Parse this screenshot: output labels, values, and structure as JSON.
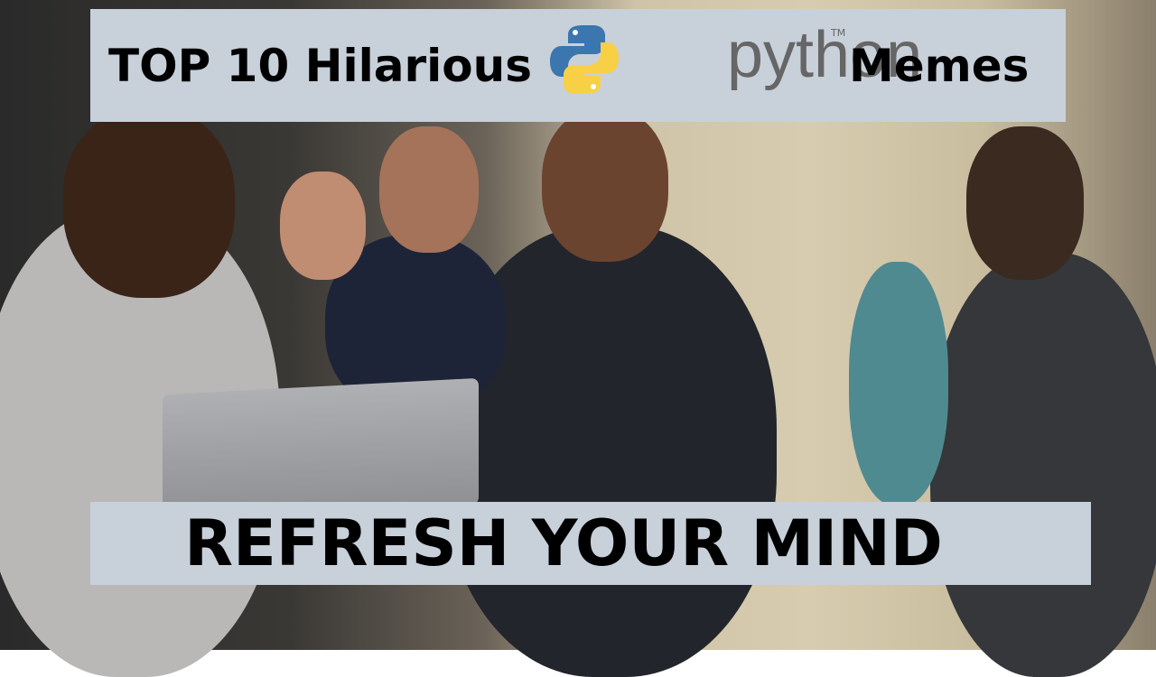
{
  "title": {
    "prefix": "TOP 10 Hilarious",
    "logo_wordmark": "python",
    "trademark": "TM",
    "suffix": "Memes"
  },
  "subtitle": "REFRESH YOUR MIND",
  "colors": {
    "banner": "#c8d0da",
    "python_blue": "#3b76ae",
    "python_yellow": "#f7d046",
    "wordmark": "#666666"
  }
}
